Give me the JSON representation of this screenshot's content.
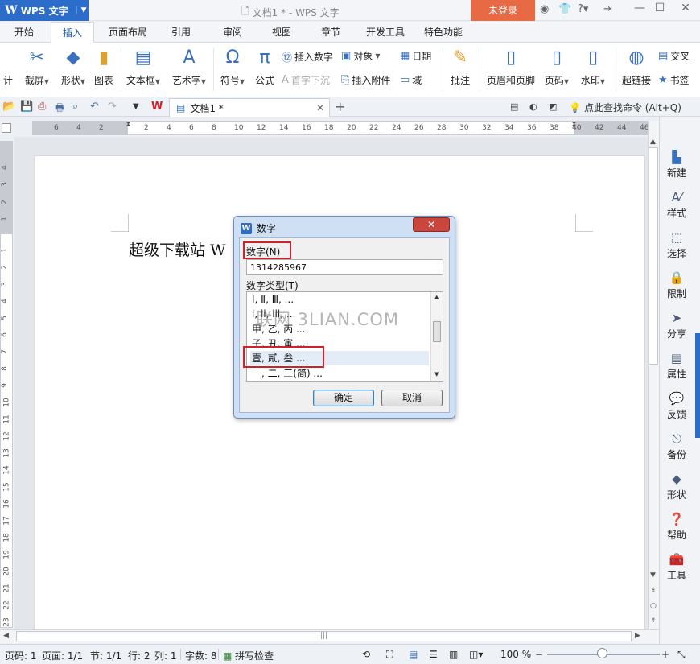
{
  "titlebar": {
    "app_name": "WPS 文字",
    "title": "文档1 * - WPS 文字",
    "login": "未登录",
    "help": "?"
  },
  "ribbon_tabs": [
    "开始",
    "插入",
    "页面布局",
    "引用",
    "审阅",
    "视图",
    "章节",
    "开发工具",
    "特色功能"
  ],
  "active_tab": "插入",
  "ribbon": {
    "screenshot": "截屏",
    "shape": "形状",
    "chart": "图表",
    "textbox": "文本框",
    "wordart": "艺术字",
    "symbol": "符号",
    "formula": "公式",
    "insert_number": "插入数字",
    "dropcap": "首字下沉",
    "object": "对象",
    "attach": "插入附件",
    "date": "日期",
    "field": "域",
    "comment": "批注",
    "header_footer": "页眉和页脚",
    "page_num": "页码",
    "watermark": "水印",
    "hyperlink": "超链接",
    "cross_ref": "交叉",
    "bookmark": "书签",
    "left_cut": "计"
  },
  "doc_tab": {
    "name": "文档1 *"
  },
  "search_cmd": "点此查找命令 (Alt+Q)",
  "hruler_numbers": [
    "6",
    "4",
    "2",
    "2",
    "4",
    "6",
    "8",
    "10",
    "12",
    "14",
    "16",
    "18",
    "20",
    "22",
    "24",
    "26",
    "28",
    "30",
    "32",
    "34",
    "36",
    "38",
    "40",
    "42",
    "44",
    "46"
  ],
  "vruler_numbers": [
    "4",
    "3",
    "2",
    "1",
    "1",
    "2",
    "3",
    "4",
    "5",
    "6",
    "7",
    "8",
    "9",
    "10",
    "11",
    "12",
    "13",
    "14",
    "15",
    "16",
    "17",
    "18",
    "19",
    "20",
    "21",
    "22",
    "23",
    "24"
  ],
  "document": {
    "text": "超级下载站 W"
  },
  "dialog": {
    "title": "数字",
    "number_label": "数字(N)",
    "number_value": "1314285967",
    "type_label": "数字类型(T)",
    "types": [
      "Ⅰ, Ⅱ, Ⅲ, ...",
      "i, ii, iii, ...",
      "甲, 乙, 丙 ...",
      "子, 丑, 寅 ...",
      "壹, 贰, 叁 ...",
      "一, 二, 三(简) ..."
    ],
    "selected_type": "壹, 贰, 叁 ...",
    "ok": "确定",
    "cancel": "取消"
  },
  "watermark_text": "联网 3LIAN.COM",
  "side_panel": [
    "新建",
    "样式",
    "选择",
    "限制",
    "分享",
    "属性",
    "反馈",
    "备份",
    "形状",
    "帮助",
    "工具"
  ],
  "statusbar": {
    "page_code": "页码: 1",
    "pages": "页面: 1/1",
    "section": "节: 1/1",
    "row": "行: 2",
    "col": "列: 1",
    "word_count": "字数: 8",
    "spell": "拼写检查",
    "zoom": "100 %"
  },
  "colors": {
    "brand_blue": "#2b6dc8",
    "login_orange": "#e86a45",
    "highlight_red": "#d0202a"
  }
}
